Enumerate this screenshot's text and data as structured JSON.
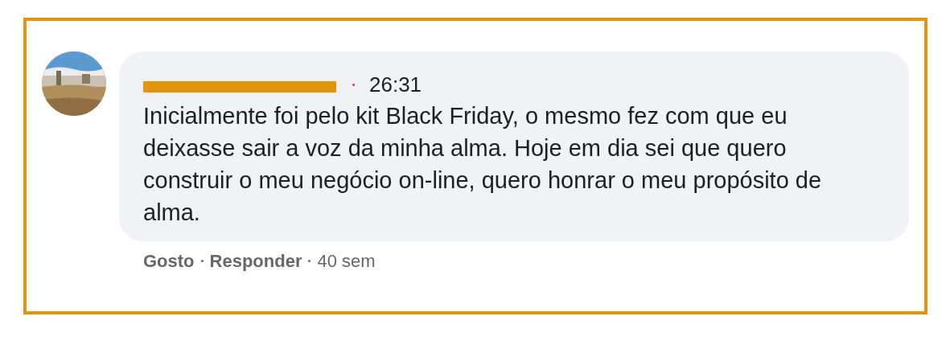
{
  "comment": {
    "author_redacted": true,
    "time": "26:31",
    "text": "Inicialmente foi pelo kit Black Friday, o mesmo fez com que eu deixasse sair a voz da minha alma. Hoje em dia sei que quero construir o meu negócio on-line, quero honrar o meu propósito de alma.",
    "actions": [
      {
        "label": "Gosto"
      },
      {
        "label": "Responder"
      }
    ],
    "age": "40 sem"
  }
}
